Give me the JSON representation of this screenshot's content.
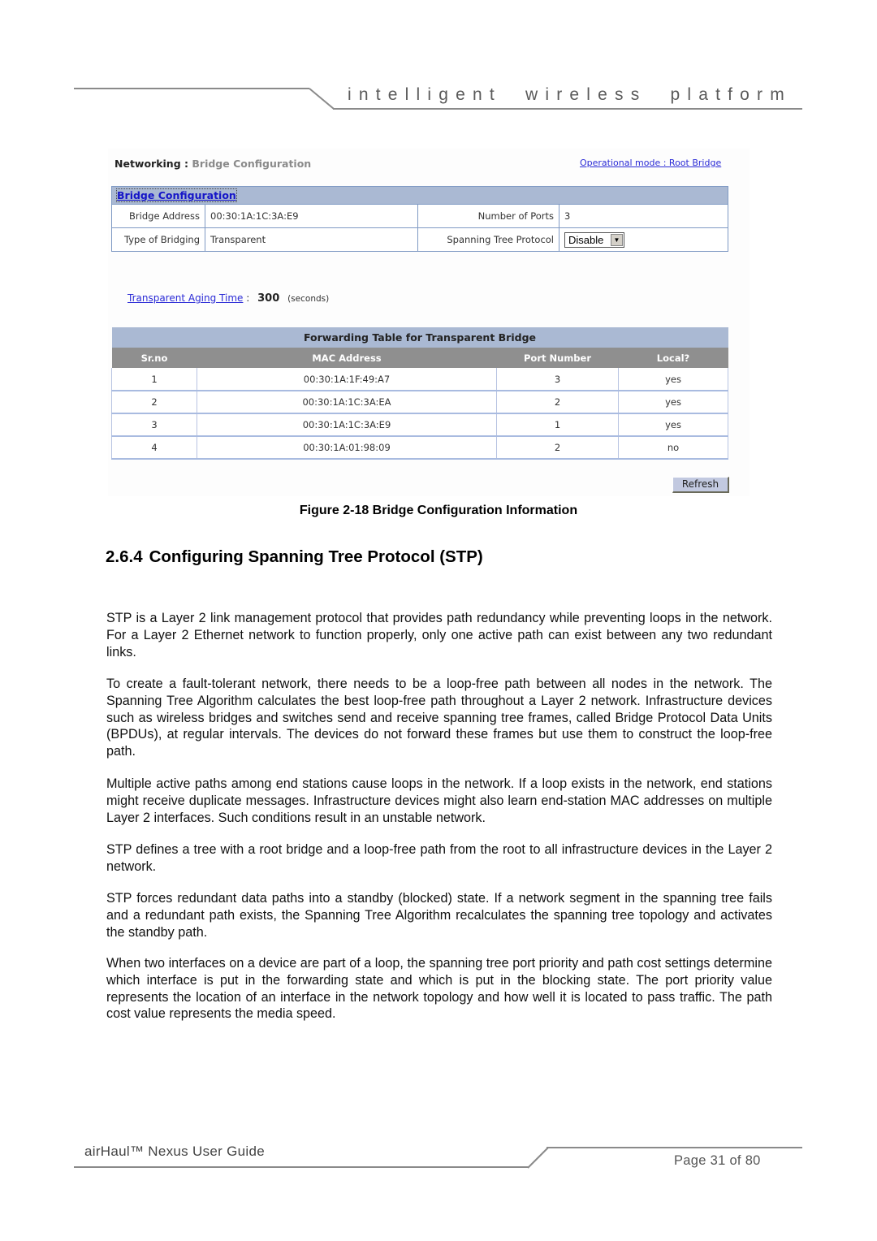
{
  "header": {
    "tagline": "intelligent wireless platform"
  },
  "figure": {
    "nav": {
      "section": "Networking :",
      "page": "Bridge Configuration"
    },
    "operational_mode_link": "Operational mode : Root Bridge",
    "bridge_config": {
      "title": "Bridge Configuration",
      "rows": [
        {
          "label1": "Bridge Address",
          "value1": "00:30:1A:1C:3A:E9",
          "label2": "Number of Ports",
          "value2": "3"
        },
        {
          "label1": "Type of Bridging",
          "value1": "Transparent",
          "label2": "Spanning Tree Protocol",
          "value2_select": "Disable"
        }
      ]
    },
    "aging": {
      "link": "Transparent Aging Time",
      "separator": ":",
      "value": "300",
      "unit": "(seconds)"
    },
    "forwarding_table": {
      "title": "Forwarding Table for Transparent Bridge",
      "columns": [
        "Sr.no",
        "MAC Address",
        "Port Number",
        "Local?"
      ],
      "rows": [
        [
          "1",
          "00:30:1A:1F:49:A7",
          "3",
          "yes"
        ],
        [
          "2",
          "00:30:1A:1C:3A:EA",
          "2",
          "yes"
        ],
        [
          "3",
          "00:30:1A:1C:3A:E9",
          "1",
          "yes"
        ],
        [
          "4",
          "00:30:1A:01:98:09",
          "2",
          "no"
        ]
      ]
    },
    "refresh_label": "Refresh",
    "caption": "Figure 2-18 Bridge Configuration Information"
  },
  "section": {
    "number": "2.6.4",
    "title": "Configuring Spanning Tree Protocol (STP)",
    "paragraphs": [
      "STP is a Layer 2 link management protocol that provides path redundancy while preventing loops in the network. For a Layer 2 Ethernet network to function properly, only one active path can exist between any two redundant links.",
      "To create a fault-tolerant network, there needs to be a loop-free path between all nodes in the network. The Spanning Tree Algorithm calculates the best loop-free path throughout a Layer 2 network. Infrastructure devices such as wireless bridges and switches send and receive spanning tree frames, called Bridge Protocol Data Units (BPDUs), at regular intervals. The devices do not forward these frames but use them to construct the loop-free path.",
      "Multiple active paths among end stations cause loops in the network. If a loop exists in the network, end stations might receive duplicate messages. Infrastructure devices might also learn end-station MAC addresses on multiple Layer 2 interfaces. Such conditions result in an unstable network.",
      "STP defines a tree with a root bridge and a loop-free path from the root to all infrastructure devices in the Layer 2 network.",
      "STP forces redundant data paths into a standby (blocked) state. If a network segment in the spanning tree fails and a redundant path exists, the Spanning Tree Algorithm recalculates the spanning tree topology and activates the standby path.",
      "When two interfaces on a device are part of a loop, the spanning tree port priority and path cost settings determine which interface is put in the forwarding state and which is put in the blocking state. The port priority value represents the location of an interface in the network topology and how well it is located to pass traffic. The path cost value represents the media speed."
    ]
  },
  "footer": {
    "guide_title": "airHaul™ Nexus User Guide",
    "page_label": "Page 31 of 80"
  }
}
